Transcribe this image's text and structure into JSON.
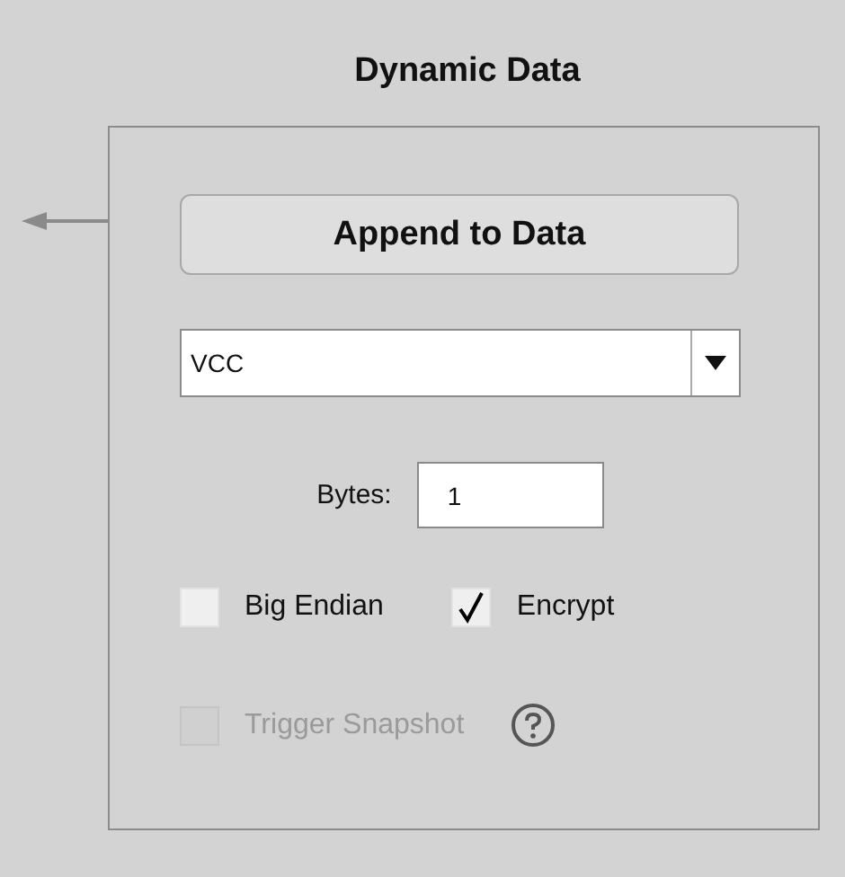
{
  "title": "Dynamic Data",
  "append_button": "Append to Data",
  "dropdown": {
    "value": "VCC"
  },
  "bytes": {
    "label": "Bytes:",
    "value": "1"
  },
  "checkboxes": [
    {
      "label": "Big Endian",
      "checked": false,
      "disabled": false
    },
    {
      "label": "Encrypt",
      "checked": true,
      "disabled": false
    },
    {
      "label": "Trigger Snapshot",
      "checked": false,
      "disabled": true
    }
  ]
}
